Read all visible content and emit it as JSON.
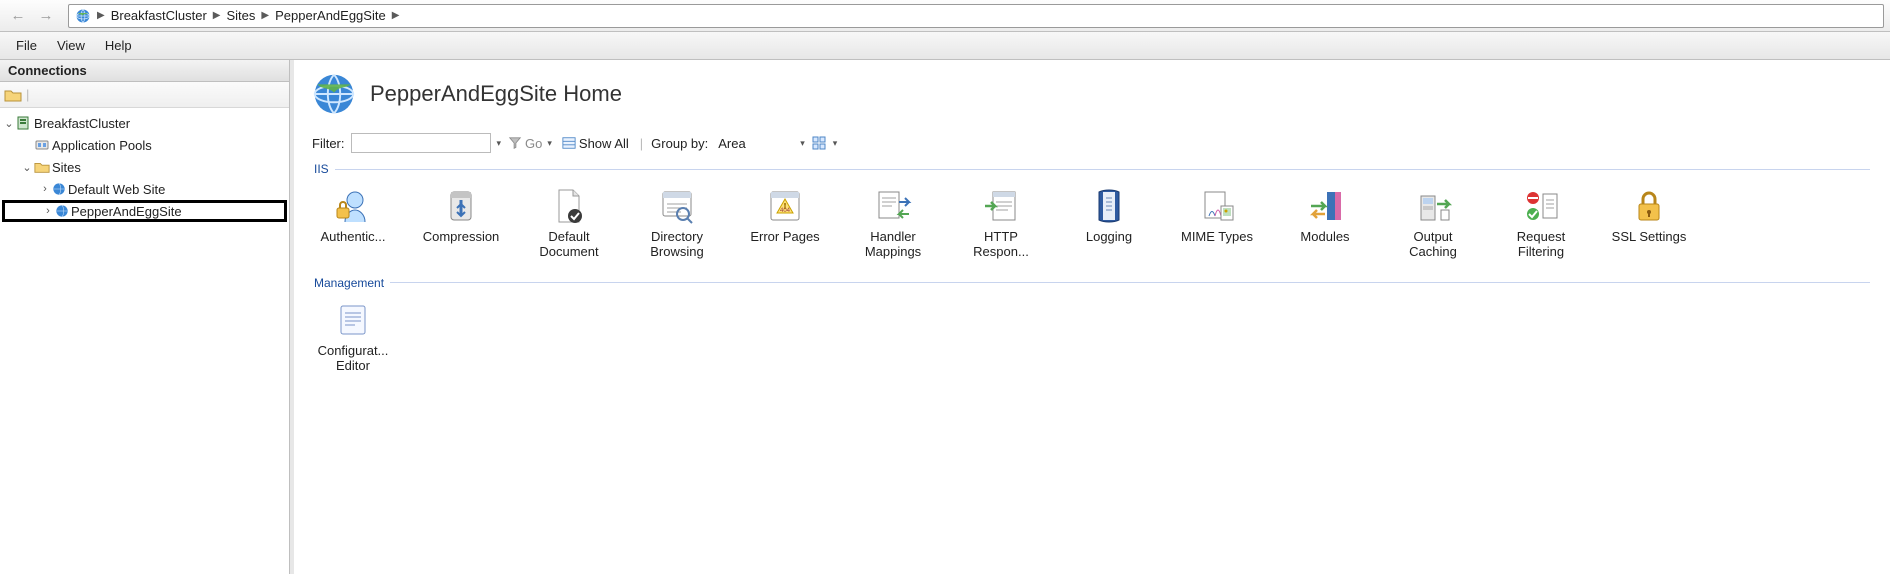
{
  "breadcrumb": {
    "items": [
      "BreakfastCluster",
      "Sites",
      "PepperAndEggSite"
    ]
  },
  "menu": {
    "items": [
      "File",
      "View",
      "Help"
    ]
  },
  "connections": {
    "header": "Connections",
    "tree": {
      "root": "BreakfastCluster",
      "app_pools": "Application Pools",
      "sites": "Sites",
      "site_default": "Default Web Site",
      "site_selected": "PepperAndEggSite"
    }
  },
  "page": {
    "title": "PepperAndEggSite Home"
  },
  "filter": {
    "label": "Filter:",
    "go": "Go",
    "show_all": "Show All",
    "group_by_label": "Group by:",
    "group_by_value": "Area"
  },
  "groups": {
    "iis": {
      "caption": "IIS",
      "items": [
        {
          "id": "authentication",
          "label": "Authentic..."
        },
        {
          "id": "compression",
          "label": "Compression"
        },
        {
          "id": "default-document",
          "label": "Default Document"
        },
        {
          "id": "directory-browsing",
          "label": "Directory Browsing"
        },
        {
          "id": "error-pages",
          "label": "Error Pages"
        },
        {
          "id": "handler-mappings",
          "label": "Handler Mappings"
        },
        {
          "id": "http-response-headers",
          "label": "HTTP Respon..."
        },
        {
          "id": "logging",
          "label": "Logging"
        },
        {
          "id": "mime-types",
          "label": "MIME Types"
        },
        {
          "id": "modules",
          "label": "Modules"
        },
        {
          "id": "output-caching",
          "label": "Output Caching"
        },
        {
          "id": "request-filtering",
          "label": "Request Filtering"
        },
        {
          "id": "ssl-settings",
          "label": "SSL Settings"
        }
      ]
    },
    "management": {
      "caption": "Management",
      "items": [
        {
          "id": "configuration-editor",
          "label": "Configurat... Editor"
        }
      ]
    }
  }
}
